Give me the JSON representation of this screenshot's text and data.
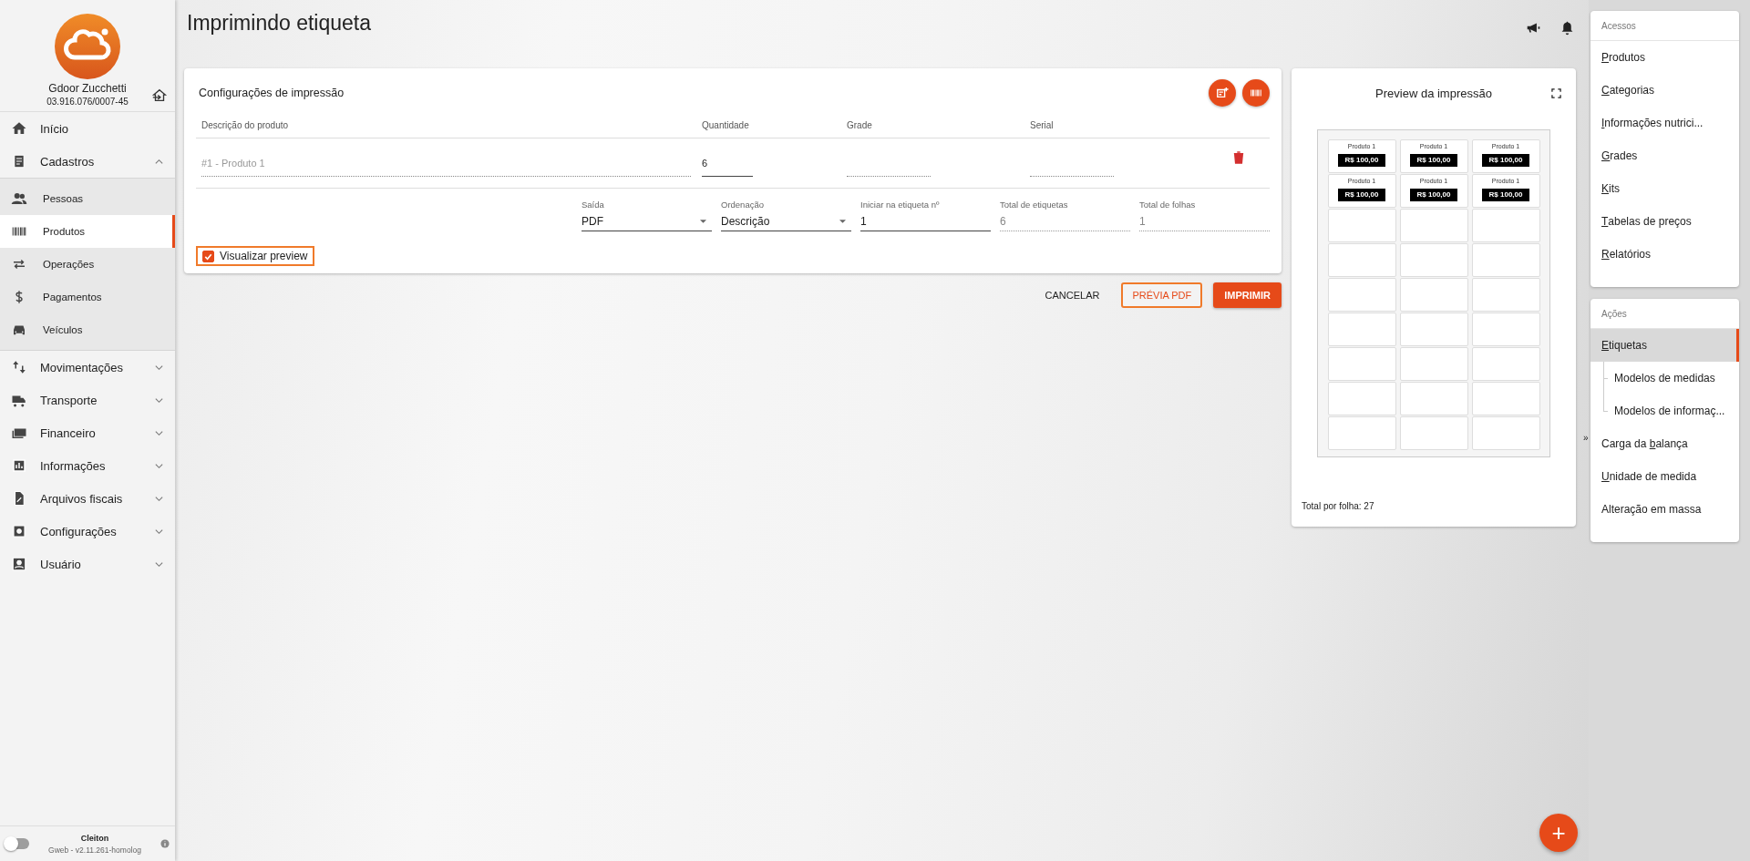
{
  "sidebar": {
    "company": "Gdoor Zucchetti",
    "document": "03.916.076/0007-45",
    "items": [
      {
        "label": "Início",
        "expandable": false
      },
      {
        "label": "Cadastros",
        "expandable": true,
        "expanded": true,
        "children": [
          {
            "label": "Pessoas",
            "selected": false
          },
          {
            "label": "Produtos",
            "selected": true
          },
          {
            "label": "Operações",
            "selected": false
          },
          {
            "label": "Pagamentos",
            "selected": false
          },
          {
            "label": "Veículos",
            "selected": false
          }
        ]
      },
      {
        "label": "Movimentações",
        "expandable": true,
        "expanded": false
      },
      {
        "label": "Transporte",
        "expandable": true,
        "expanded": false
      },
      {
        "label": "Financeiro",
        "expandable": true,
        "expanded": false
      },
      {
        "label": "Informações",
        "expandable": true,
        "expanded": false
      },
      {
        "label": "Arquivos fiscais",
        "expandable": true,
        "expanded": false
      },
      {
        "label": "Configurações",
        "expandable": true,
        "expanded": false
      },
      {
        "label": "Usuário",
        "expandable": true,
        "expanded": false
      }
    ],
    "footer": {
      "user": "Cleiton",
      "version": "Gweb - v2.11.261-homolog",
      "dark_mode": false
    }
  },
  "page": {
    "title": "Imprimindo etiqueta"
  },
  "config": {
    "title": "Configurações de impressão",
    "columns": [
      "Descrição do produto",
      "Quantidade",
      "Grade",
      "Serial"
    ],
    "rows": [
      {
        "product": "#1 - Produto 1",
        "quantity": "6",
        "grade": "",
        "serial": ""
      }
    ],
    "fields": [
      {
        "kind": "select",
        "label": "Saída",
        "value": "PDF"
      },
      {
        "kind": "select",
        "label": "Ordenação",
        "value": "Descrição"
      },
      {
        "kind": "input",
        "label": "Iniciar na etiqueta nº",
        "value": "1"
      },
      {
        "kind": "readonly",
        "label": "Total de etiquetas",
        "value": "6"
      },
      {
        "kind": "readonly",
        "label": "Total de folhas",
        "value": "1"
      }
    ],
    "preview_checkbox": {
      "label": "Visualizar preview",
      "checked": true
    }
  },
  "actions": [
    {
      "kind": "text",
      "label": "CANCELAR",
      "focused": false
    },
    {
      "kind": "outlined",
      "label": "PRÉVIA PDF",
      "focused": true
    },
    {
      "kind": "filled",
      "label": "IMPRIMIR",
      "focused": false
    }
  ],
  "preview": {
    "title": "Preview da impressão",
    "total": "Total por folha: 27",
    "labels": [
      {
        "name": "Produto 1",
        "price": "R$ 100,00"
      },
      {
        "name": "Produto 1",
        "price": "R$ 100,00"
      },
      {
        "name": "Produto 1",
        "price": "R$ 100,00"
      },
      {
        "name": "Produto 1",
        "price": "R$ 100,00"
      },
      {
        "name": "Produto 1",
        "price": "R$ 100,00"
      },
      {
        "name": "Produto 1",
        "price": "R$ 100,00"
      }
    ]
  },
  "right_panel": {
    "collapse_glyph": "»",
    "sections": [
      {
        "title": "Acessos",
        "items": [
          {
            "hotkey": "P",
            "after": "rodutos",
            "selected": false
          },
          {
            "hotkey": "C",
            "after": "ategorias",
            "selected": false
          },
          {
            "hotkey": "I",
            "after": "nformações nutrici...",
            "selected": false
          },
          {
            "hotkey": "G",
            "after": "rades",
            "selected": false
          },
          {
            "hotkey": "K",
            "after": "its",
            "selected": false
          },
          {
            "hotkey": "T",
            "after": "abelas de preços",
            "selected": false
          },
          {
            "hotkey": "R",
            "after": "elatórios",
            "selected": false
          }
        ]
      },
      {
        "title": "Ações",
        "items": [
          {
            "hotkey": "E",
            "after": "tiquetas",
            "selected": true,
            "children": [
              {
                "label": "Modelos de medidas",
                "selected": false
              },
              {
                "label": "Modelos de informaç...",
                "selected": false
              }
            ]
          },
          {
            "before": "Carga da ",
            "hotkey": "b",
            "after": "alança",
            "selected": false
          },
          {
            "hotkey": "U",
            "after": "nidade de medida",
            "selected": false
          },
          {
            "label": "Alteração em massa",
            "selected": false
          }
        ]
      }
    ]
  },
  "fab": {
    "label": "+"
  }
}
